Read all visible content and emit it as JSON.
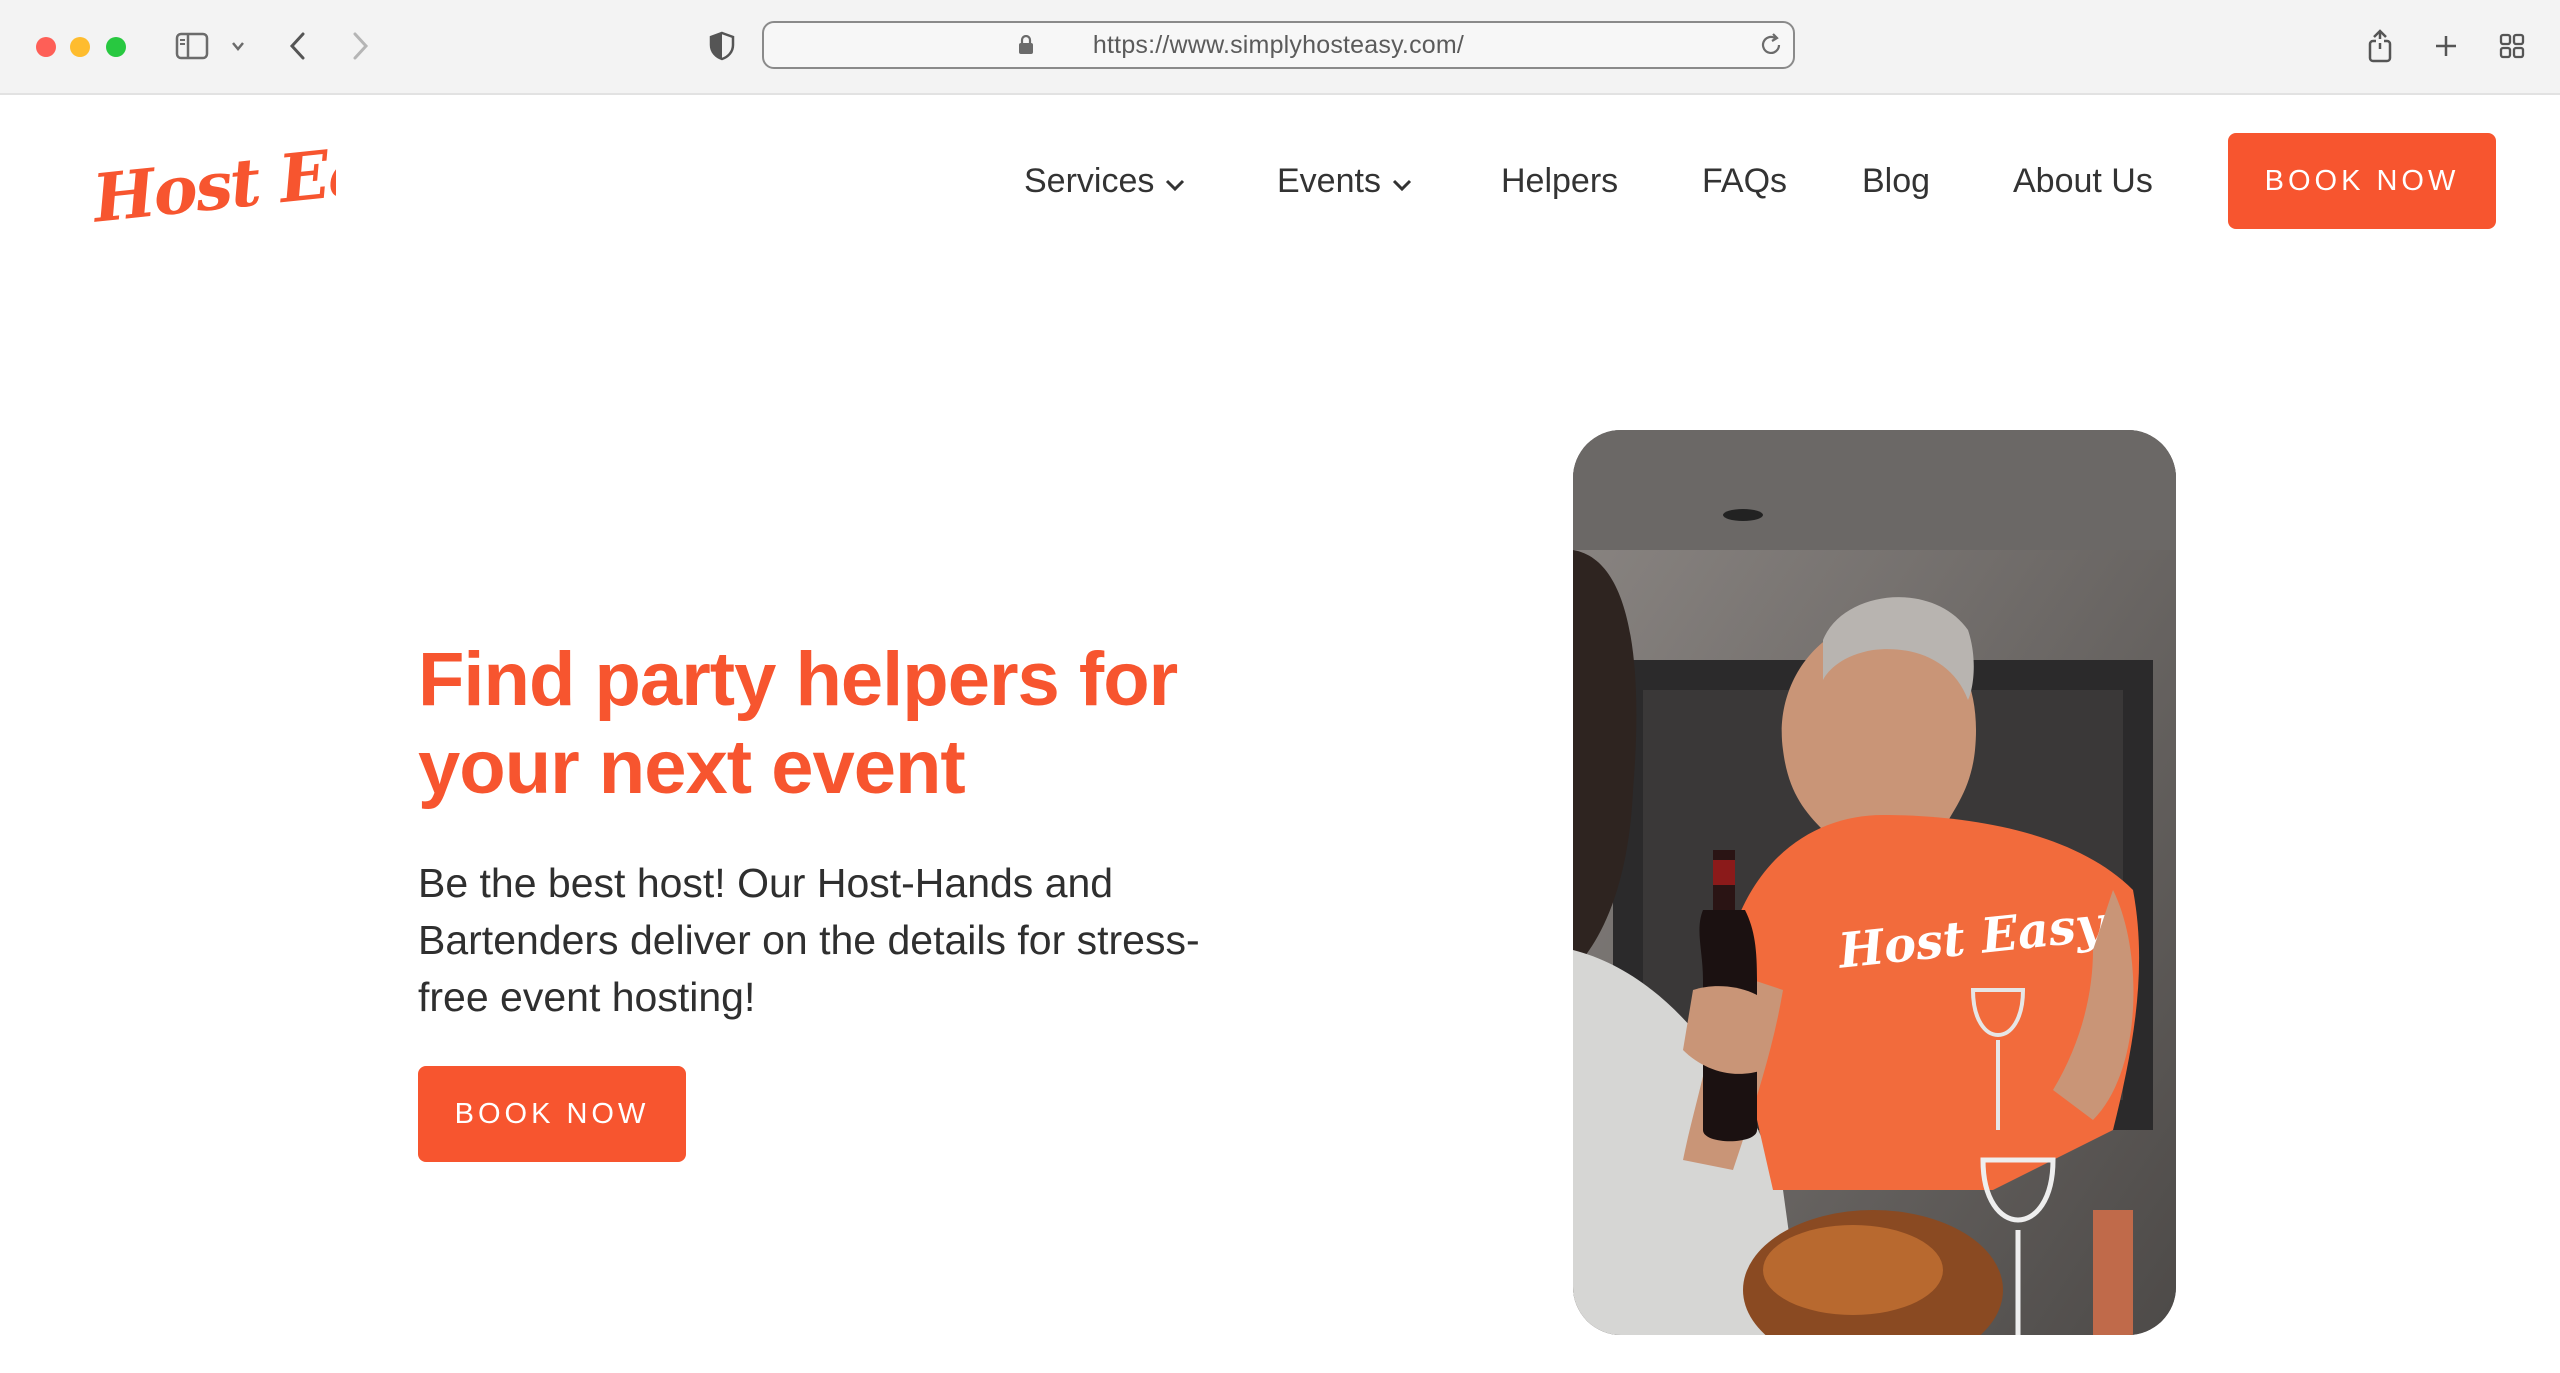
{
  "browser": {
    "url": "https://www.simplyhosteasy.com/"
  },
  "site": {
    "logo_text": "Host Easy",
    "brand_color": "#f7552f"
  },
  "nav": {
    "items": [
      {
        "label": "Services",
        "has_dropdown": true
      },
      {
        "label": "Events",
        "has_dropdown": true
      },
      {
        "label": "Helpers",
        "has_dropdown": false
      },
      {
        "label": "FAQs",
        "has_dropdown": false
      },
      {
        "label": "Blog",
        "has_dropdown": false
      },
      {
        "label": "About Us",
        "has_dropdown": false
      }
    ],
    "cta_label": "BOOK NOW"
  },
  "hero": {
    "title_line1": "Find party helpers for",
    "title_line2": "your next event",
    "subtitle_line1": "Be the best host! Our Host-Hands and",
    "subtitle_line2": "Bartenders deliver on the details for stress-",
    "subtitle_line3": "free event hosting!",
    "cta_label": "BOOK NOW",
    "image_shirt_text": "Host Easy"
  }
}
